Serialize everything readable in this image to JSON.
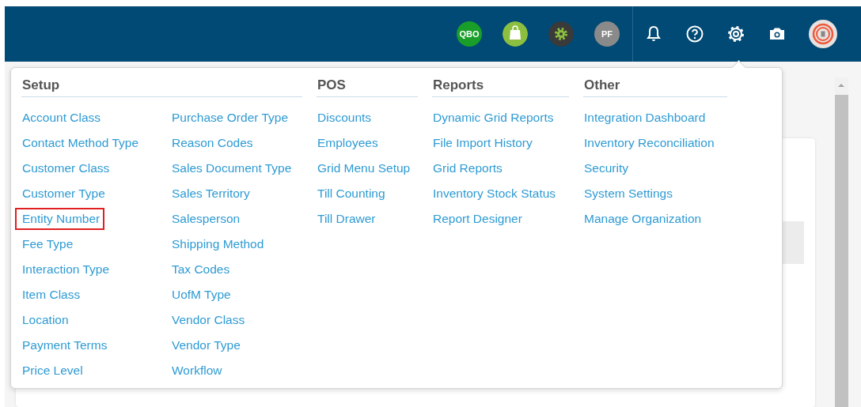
{
  "top_bar": {
    "integrations": [
      {
        "kind": "text",
        "label": "QBO",
        "color": "#1a9e2a"
      },
      {
        "kind": "bag",
        "color": "#8cbf3f"
      },
      {
        "kind": "gear",
        "color": "#3a3a3a"
      },
      {
        "kind": "text",
        "label": "PF",
        "color": "#8a8a8a"
      }
    ],
    "actions": [
      {
        "kind": "bell"
      },
      {
        "kind": "help"
      },
      {
        "kind": "settings"
      },
      {
        "kind": "camera"
      },
      {
        "kind": "avatar"
      }
    ]
  },
  "menu": {
    "sections": [
      {
        "title": "Setup",
        "columns": [
          [
            {
              "label": "Account Class",
              "highlighted": false
            },
            {
              "label": "Contact Method Type",
              "highlighted": false
            },
            {
              "label": "Customer Class",
              "highlighted": false
            },
            {
              "label": "Customer Type",
              "highlighted": false
            },
            {
              "label": "Entity Number",
              "highlighted": true
            },
            {
              "label": "Fee Type",
              "highlighted": false
            },
            {
              "label": "Interaction Type",
              "highlighted": false
            },
            {
              "label": "Item Class",
              "highlighted": false
            },
            {
              "label": "Location",
              "highlighted": false
            },
            {
              "label": "Payment Terms",
              "highlighted": false
            },
            {
              "label": "Price Level",
              "highlighted": false
            }
          ],
          [
            {
              "label": "Purchase Order Type",
              "highlighted": false
            },
            {
              "label": "Reason Codes",
              "highlighted": false
            },
            {
              "label": "Sales Document Type",
              "highlighted": false
            },
            {
              "label": "Sales Territory",
              "highlighted": false
            },
            {
              "label": "Salesperson",
              "highlighted": false
            },
            {
              "label": "Shipping Method",
              "highlighted": false
            },
            {
              "label": "Tax Codes",
              "highlighted": false
            },
            {
              "label": "UofM Type",
              "highlighted": false
            },
            {
              "label": "Vendor Class",
              "highlighted": false
            },
            {
              "label": "Vendor Type",
              "highlighted": false
            },
            {
              "label": "Workflow",
              "highlighted": false
            }
          ]
        ]
      },
      {
        "title": "POS",
        "columns": [
          [
            {
              "label": "Discounts",
              "highlighted": false
            },
            {
              "label": "Employees",
              "highlighted": false
            },
            {
              "label": "Grid Menu Setup",
              "highlighted": false
            },
            {
              "label": "Till Counting",
              "highlighted": false
            },
            {
              "label": "Till Drawer",
              "highlighted": false
            }
          ]
        ]
      },
      {
        "title": "Reports",
        "columns": [
          [
            {
              "label": "Dynamic Grid Reports",
              "highlighted": false
            },
            {
              "label": "File Import History",
              "highlighted": false
            },
            {
              "label": "Grid Reports",
              "highlighted": false
            },
            {
              "label": "Inventory Stock Status",
              "highlighted": false
            },
            {
              "label": "Report Designer",
              "highlighted": false
            }
          ]
        ]
      },
      {
        "title": "Other",
        "columns": [
          [
            {
              "label": "Integration Dashboard",
              "highlighted": false
            },
            {
              "label": "Inventory Reconciliation",
              "highlighted": false
            },
            {
              "label": "Security",
              "highlighted": false
            },
            {
              "label": "System Settings",
              "highlighted": false
            },
            {
              "label": "Manage Organization",
              "highlighted": false
            }
          ]
        ]
      }
    ]
  }
}
